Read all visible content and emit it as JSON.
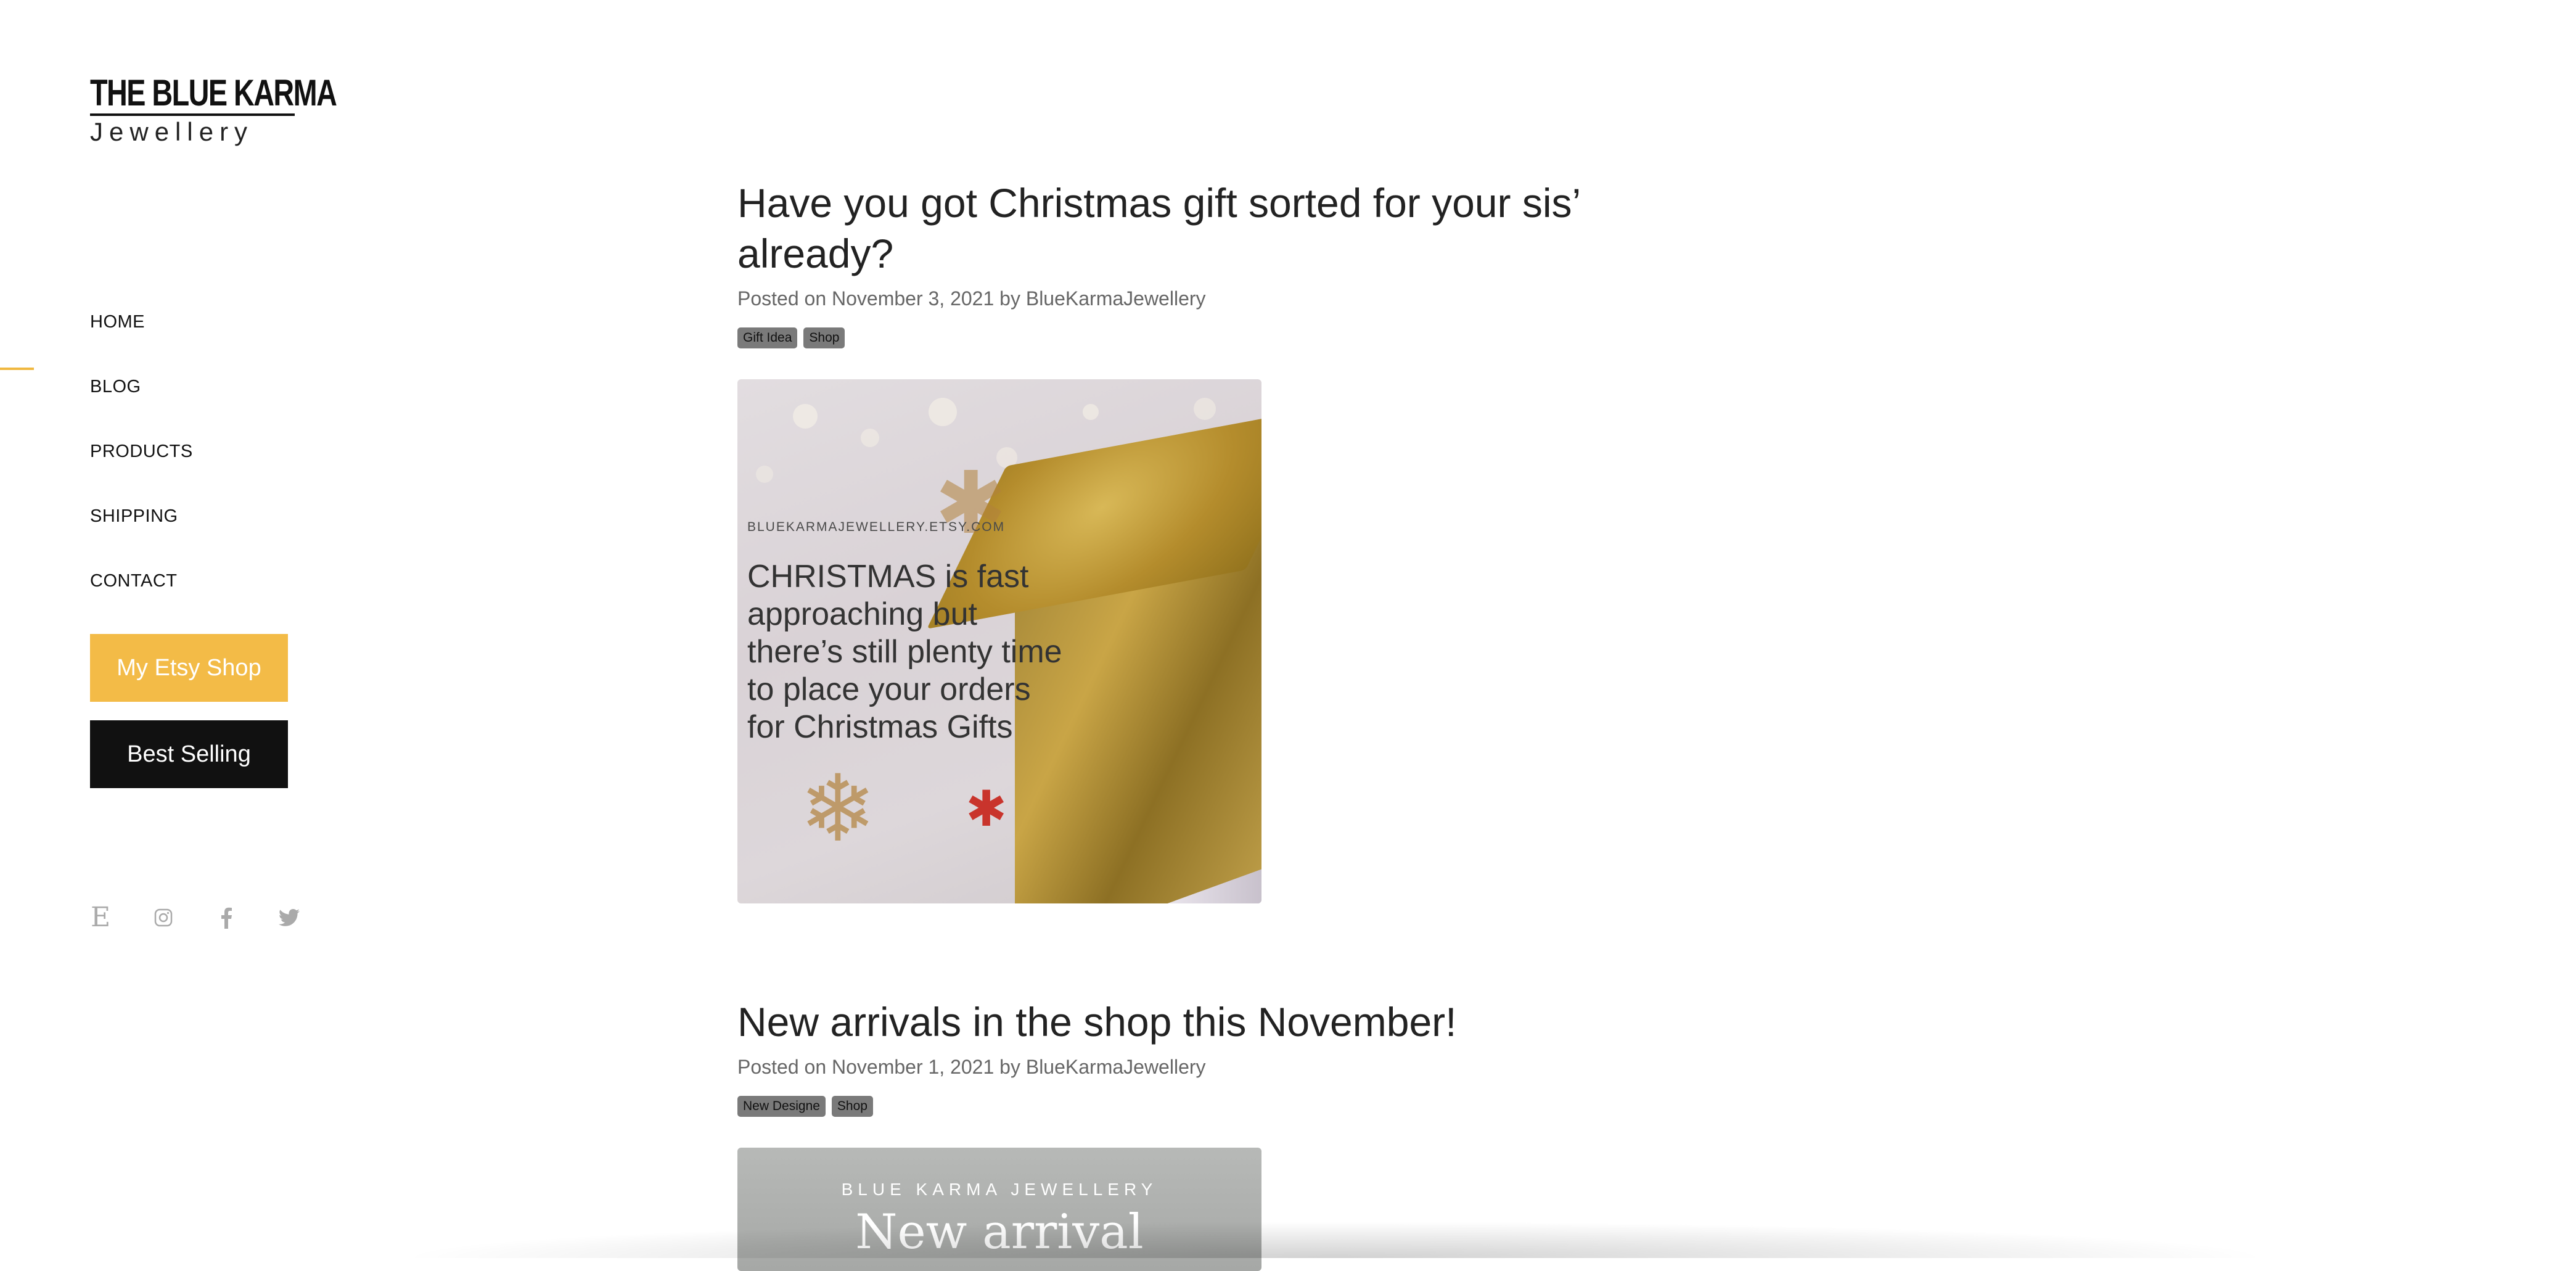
{
  "logo": {
    "line1": "THE BLUE KARMA",
    "line2": "Jewellery"
  },
  "nav": {
    "active": "BLOG",
    "items": [
      {
        "label": "HOME"
      },
      {
        "label": "BLOG"
      },
      {
        "label": "PRODUCTS"
      },
      {
        "label": "SHIPPING"
      },
      {
        "label": "CONTACT"
      }
    ]
  },
  "buttons": {
    "etsy": "My Etsy Shop",
    "best": "Best Selling"
  },
  "social": [
    "etsy-icon",
    "instagram-icon",
    "facebook-icon",
    "twitter-icon"
  ],
  "posts": [
    {
      "title": "Have you got Christmas gift sorted for your sis’ already?",
      "meta_prefix": "Posted on ",
      "date": "November 3, 2021",
      "meta_by": " by ",
      "author": "BlueKarmaJewellery",
      "tags": [
        "Gift Idea",
        "Shop"
      ],
      "image": {
        "url_text": "BLUEKARMAJEWELLERY.ETSY.COM",
        "text": "CHRISTMAS is fast approaching but there’s still plenty time to place your orders for Christmas Gifts"
      }
    },
    {
      "title": "New arrivals in the shop this November!",
      "meta_prefix": "Posted on ",
      "date": "November 1, 2021",
      "meta_by": " by ",
      "author": "BlueKarmaJewellery",
      "tags": [
        "New Designe",
        "Shop"
      ],
      "image": {
        "brand": "BLUE  KARMA JEWELLERY",
        "heading": "New arrival"
      }
    }
  ],
  "colors": {
    "accent": "#f3bb47",
    "dark_button": "#111111",
    "tag_bg": "#7a7a7a",
    "nav_indicator": "#f0b840"
  }
}
